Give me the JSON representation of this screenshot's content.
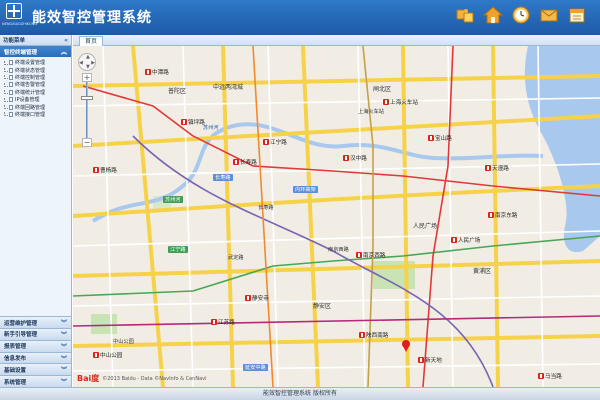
{
  "header": {
    "logo_caption": "NENGXIAOZHIKONG",
    "title": "能效智控管理系统",
    "toolbar": [
      {
        "icon": "puzzle-icon"
      },
      {
        "icon": "home-icon"
      },
      {
        "icon": "clock-icon"
      },
      {
        "icon": "mail-icon"
      },
      {
        "icon": "calendar-icon"
      }
    ]
  },
  "sidebar": {
    "header": "功能菜单",
    "collapse_glyph": "«",
    "active_section": "智控终端管理",
    "tree_items": [
      "终端设置管理",
      "终端状态管理",
      "终端控制管理",
      "终端告警管理",
      "终端统计管理",
      "IP设备管理",
      "终端回路管理",
      "终端接口管理"
    ],
    "bottom_menus": [
      "运营维护管理",
      "新手引导管理",
      "报表管理",
      "信息发布",
      "基础设置",
      "系统管理"
    ]
  },
  "main": {
    "tab_label": "首页"
  },
  "map": {
    "road_color": "#fbe37e",
    "water_color": "#a9c8ee",
    "district_labels": [
      "苏州河",
      "中远两湾城",
      "长寿路",
      "普陀区",
      "闸北区",
      "静安区",
      "人民广场",
      "上海火车站",
      "南京西路",
      "武定路",
      "中山公园",
      "黄浦区"
    ],
    "metro_stations": [
      "中潭路",
      "镇坪路",
      "曹杨路",
      "江宁路",
      "长寿路",
      "人民广场",
      "南京西路",
      "南京东路",
      "静安寺",
      "江苏路",
      "中山公园",
      "陕西南路",
      "新天地",
      "汉中路",
      "上海火车站",
      "宝山路",
      "天潼路",
      "马当路"
    ],
    "road_tags": [
      "长寿路",
      "苏州河",
      "内环高架",
      "江宁路",
      "延安中路"
    ],
    "copyright": "©2013 Baidu - Data ©NavInfo & CenNavi",
    "baidu_logo": "Bai度"
  },
  "footer": {
    "text": "能效智控管理系统 版权所有"
  }
}
